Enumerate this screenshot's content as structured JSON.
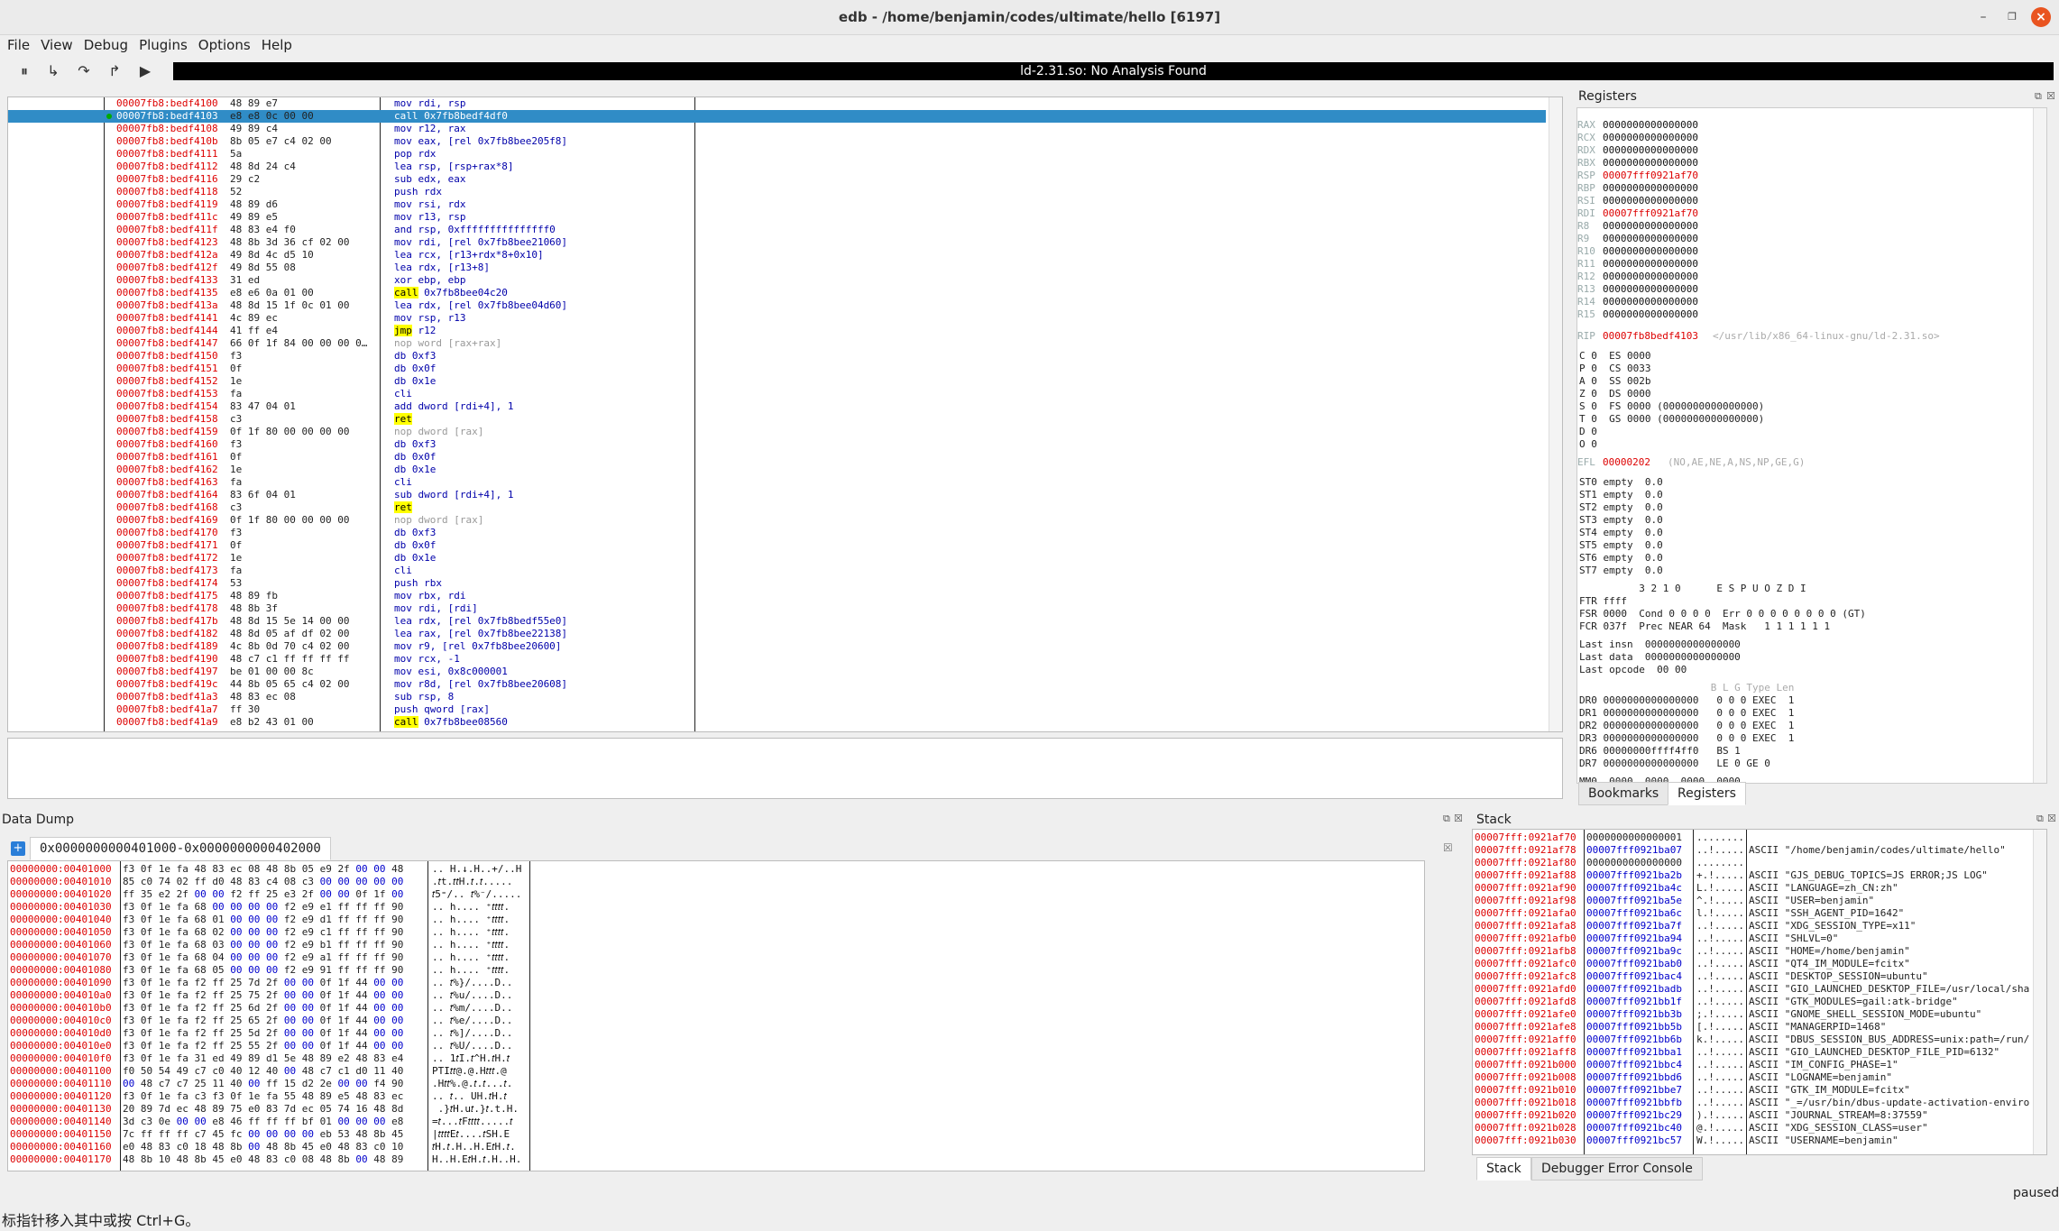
{
  "window": {
    "title": "edb - /home/benjamin/codes/ultimate/hello [6197]"
  },
  "menu": [
    "File",
    "View",
    "Debug",
    "Plugins",
    "Options",
    "Help"
  ],
  "toolbar": {
    "analysis_status": "ld-2.31.so: No Analysis Found"
  },
  "disasm": {
    "rows": [
      [
        "00007fb8:bedf4100",
        "48 89 e7",
        "mov rdi, rsp"
      ],
      [
        "00007fb8:bedf4103",
        "e8 e8 0c 00 00",
        "call 0x7fb8bedf4df0"
      ],
      [
        "00007fb8:bedf4108",
        "49 89 c4",
        "mov r12, rax"
      ],
      [
        "00007fb8:bedf410b",
        "8b 05 e7 c4 02 00",
        "mov eax, [rel 0x7fb8bee205f8]"
      ],
      [
        "00007fb8:bedf4111",
        "5a",
        "pop rdx"
      ],
      [
        "00007fb8:bedf4112",
        "48 8d 24 c4",
        "lea rsp, [rsp+rax*8]"
      ],
      [
        "00007fb8:bedf4116",
        "29 c2",
        "sub edx, eax"
      ],
      [
        "00007fb8:bedf4118",
        "52",
        "push rdx"
      ],
      [
        "00007fb8:bedf4119",
        "48 89 d6",
        "mov rsi, rdx"
      ],
      [
        "00007fb8:bedf411c",
        "49 89 e5",
        "mov r13, rsp"
      ],
      [
        "00007fb8:bedf411f",
        "48 83 e4 f0",
        "and rsp, 0xfffffffffffffff0"
      ],
      [
        "00007fb8:bedf4123",
        "48 8b 3d 36 cf 02 00",
        "mov rdi, [rel 0x7fb8bee21060]"
      ],
      [
        "00007fb8:bedf412a",
        "49 8d 4c d5 10",
        "lea rcx, [r13+rdx*8+0x10]"
      ],
      [
        "00007fb8:bedf412f",
        "49 8d 55 08",
        "lea rdx, [r13+8]"
      ],
      [
        "00007fb8:bedf4133",
        "31 ed",
        "xor ebp, ebp"
      ],
      [
        "00007fb8:bedf4135",
        "e8 e6 0a 01 00",
        "call 0x7fb8bee04c20"
      ],
      [
        "00007fb8:bedf413a",
        "48 8d 15 1f 0c 01 00",
        "lea rdx, [rel 0x7fb8bee04d60]"
      ],
      [
        "00007fb8:bedf4141",
        "4c 89 ec",
        "mov rsp, r13"
      ],
      [
        "00007fb8:bedf4144",
        "41 ff e4",
        "jmp r12"
      ],
      [
        "00007fb8:bedf4147",
        "66 0f 1f 84 00 00 00 0…",
        "nop word [rax+rax]"
      ],
      [
        "00007fb8:bedf4150",
        "f3",
        "db 0xf3"
      ],
      [
        "00007fb8:bedf4151",
        "0f",
        "db 0x0f"
      ],
      [
        "00007fb8:bedf4152",
        "1e",
        "db 0x1e"
      ],
      [
        "00007fb8:bedf4153",
        "fa",
        "cli"
      ],
      [
        "00007fb8:bedf4154",
        "83 47 04 01",
        "add dword [rdi+4], 1"
      ],
      [
        "00007fb8:bedf4158",
        "c3",
        "ret"
      ],
      [
        "00007fb8:bedf4159",
        "0f 1f 80 00 00 00 00",
        "nop dword [rax]"
      ],
      [
        "00007fb8:bedf4160",
        "f3",
        "db 0xf3"
      ],
      [
        "00007fb8:bedf4161",
        "0f",
        "db 0x0f"
      ],
      [
        "00007fb8:bedf4162",
        "1e",
        "db 0x1e"
      ],
      [
        "00007fb8:bedf4163",
        "fa",
        "cli"
      ],
      [
        "00007fb8:bedf4164",
        "83 6f 04 01",
        "sub dword [rdi+4], 1"
      ],
      [
        "00007fb8:bedf4168",
        "c3",
        "ret"
      ],
      [
        "00007fb8:bedf4169",
        "0f 1f 80 00 00 00 00",
        "nop dword [rax]"
      ],
      [
        "00007fb8:bedf4170",
        "f3",
        "db 0xf3"
      ],
      [
        "00007fb8:bedf4171",
        "0f",
        "db 0x0f"
      ],
      [
        "00007fb8:bedf4172",
        "1e",
        "db 0x1e"
      ],
      [
        "00007fb8:bedf4173",
        "fa",
        "cli"
      ],
      [
        "00007fb8:bedf4174",
        "53",
        "push rbx"
      ],
      [
        "00007fb8:bedf4175",
        "48 89 fb",
        "mov rbx, rdi"
      ],
      [
        "00007fb8:bedf4178",
        "48 8b 3f",
        "mov rdi, [rdi]"
      ],
      [
        "00007fb8:bedf417b",
        "48 8d 15 5e 14 00 00",
        "lea rdx, [rel 0x7fb8bedf55e0]"
      ],
      [
        "00007fb8:bedf4182",
        "48 8d 05 af df 02 00",
        "lea rax, [rel 0x7fb8bee22138]"
      ],
      [
        "00007fb8:bedf4189",
        "4c 8b 0d 70 c4 02 00",
        "mov r9, [rel 0x7fb8bee20600]"
      ],
      [
        "00007fb8:bedf4190",
        "48 c7 c1 ff ff ff ff",
        "mov rcx, -1"
      ],
      [
        "00007fb8:bedf4197",
        "be 01 00 00 8c",
        "mov esi, 0x8c000001"
      ],
      [
        "00007fb8:bedf419c",
        "44 8b 05 65 c4 02 00",
        "mov r8d, [rel 0x7fb8bee20608]"
      ],
      [
        "00007fb8:bedf41a3",
        "48 83 ec 08",
        "sub rsp, 8"
      ],
      [
        "00007fb8:bedf41a7",
        "ff 30",
        "push qword [rax]"
      ],
      [
        "00007fb8:bedf41a9",
        "e8 b2 43 01 00",
        "call 0x7fb8bee08560"
      ]
    ]
  },
  "registers": {
    "title": "Registers",
    "gp": [
      [
        "RAX",
        "0000000000000000"
      ],
      [
        "RCX",
        "0000000000000000"
      ],
      [
        "RDX",
        "0000000000000000"
      ],
      [
        "RBX",
        "0000000000000000"
      ],
      [
        "RSP",
        "00007fff0921af70"
      ],
      [
        "RBP",
        "0000000000000000"
      ],
      [
        "RSI",
        "0000000000000000"
      ],
      [
        "RDI",
        "00007fff0921af70"
      ],
      [
        "R8",
        "0000000000000000"
      ],
      [
        "R9",
        "0000000000000000"
      ],
      [
        "R10",
        "0000000000000000"
      ],
      [
        "R11",
        "0000000000000000"
      ],
      [
        "R12",
        "0000000000000000"
      ],
      [
        "R13",
        "0000000000000000"
      ],
      [
        "R14",
        "0000000000000000"
      ],
      [
        "R15",
        "0000000000000000"
      ]
    ],
    "rip": [
      "RIP",
      "00007fb8bedf4103",
      "</usr/lib/x86_64-linux-gnu/ld-2.31.so>"
    ],
    "flags_seg": [
      "C 0  ES 0000",
      "P 0  CS 0033",
      "A 0  SS 002b",
      "Z 0  DS 0000",
      "S 0  FS 0000 (0000000000000000)",
      "T 0  GS 0000 (0000000000000000)",
      "D 0",
      "O 0"
    ],
    "efl": [
      "EFL",
      "00000202",
      "(NO,AE,NE,A,NS,NP,GE,G)"
    ],
    "fpu": [
      "ST0 empty  0.0",
      "ST1 empty  0.0",
      "ST2 empty  0.0",
      "ST3 empty  0.0",
      "ST4 empty  0.0",
      "ST5 empty  0.0",
      "ST6 empty  0.0",
      "ST7 empty  0.0"
    ],
    "fpu_ctl": [
      "          3 2 1 0      E S P U O Z D I",
      "FTR ffff",
      "FSR 0000  Cond 0 0 0 0  Err 0 0 0 0 0 0 0 0 (GT)",
      "FCR 037f  Prec NEAR 64  Mask   1 1 1 1 1 1"
    ],
    "last": [
      "Last insn  0000000000000000",
      "Last data  0000000000000000",
      "Last opcode  00 00"
    ],
    "dr_header": "                      B L G Type Len",
    "dr": [
      "DR0 0000000000000000   0 0 0 EXEC  1",
      "DR1 0000000000000000   0 0 0 EXEC  1",
      "DR2 0000000000000000   0 0 0 EXEC  1",
      "DR3 0000000000000000   0 0 0 EXEC  1",
      "DR6 00000000ffff4ff0   BS 1",
      "DR7 0000000000000000   LE 0 GE 0"
    ],
    "mm0": "MM0  0000  0000  0000  0000",
    "tabs": [
      "Bookmarks",
      "Registers"
    ]
  },
  "data_dump": {
    "title": "Data Dump",
    "tab": "0x0000000000401000-0x0000000000402000",
    "rows": [
      [
        "00000000:00401000",
        "f3 0f 1e fa 48 83 ec 08 48 8b 05 e9 2f 00 00 48",
        ".. H.↓.H..+/..H"
      ],
      [
        "00000000:00401010",
        "85 c0 74 02 ff d0 48 83 c4 08 c3 00 00 00 00 00",
        ".𝑡t.𝑡𝑡H.𝑡.𝑡....."
      ],
      [
        "00000000:00401020",
        "ff 35 e2 2f 00 00 f2 ff 25 e3 2f 00 00 0f 1f 00",
        "𝑡5⁼/.. 𝑡%⁻/....."
      ],
      [
        "00000000:00401030",
        "f3 0f 1e fa 68 00 00 00 00 f2 e9 e1 ff ff ff 90",
        ".. h.... ⁺𝑡𝑡𝑡𝑡."
      ],
      [
        "00000000:00401040",
        "f3 0f 1e fa 68 01 00 00 00 f2 e9 d1 ff ff ff 90",
        ".. h.... ⁺𝑡𝑡𝑡𝑡."
      ],
      [
        "00000000:00401050",
        "f3 0f 1e fa 68 02 00 00 00 f2 e9 c1 ff ff ff 90",
        ".. h.... ⁺𝑡𝑡𝑡𝑡."
      ],
      [
        "00000000:00401060",
        "f3 0f 1e fa 68 03 00 00 00 f2 e9 b1 ff ff ff 90",
        ".. h.... ⁺𝑡𝑡𝑡𝑡."
      ],
      [
        "00000000:00401070",
        "f3 0f 1e fa 68 04 00 00 00 f2 e9 a1 ff ff ff 90",
        ".. h.... ⁺𝑡𝑡𝑡𝑡."
      ],
      [
        "00000000:00401080",
        "f3 0f 1e fa 68 05 00 00 00 f2 e9 91 ff ff ff 90",
        ".. h.... ⁺𝑡𝑡𝑡𝑡."
      ],
      [
        "00000000:00401090",
        "f3 0f 1e fa f2 ff 25 7d 2f 00 00 0f 1f 44 00 00",
        ".. 𝑡%}/....D.."
      ],
      [
        "00000000:004010a0",
        "f3 0f 1e fa f2 ff 25 75 2f 00 00 0f 1f 44 00 00",
        ".. 𝑡%u/....D.."
      ],
      [
        "00000000:004010b0",
        "f3 0f 1e fa f2 ff 25 6d 2f 00 00 0f 1f 44 00 00",
        ".. 𝑡%m/....D.."
      ],
      [
        "00000000:004010c0",
        "f3 0f 1e fa f2 ff 25 65 2f 00 00 0f 1f 44 00 00",
        ".. 𝑡%e/....D.."
      ],
      [
        "00000000:004010d0",
        "f3 0f 1e fa f2 ff 25 5d 2f 00 00 0f 1f 44 00 00",
        ".. 𝑡%]/....D.."
      ],
      [
        "00000000:004010e0",
        "f3 0f 1e fa f2 ff 25 55 2f 00 00 0f 1f 44 00 00",
        ".. 𝑡%U/....D.."
      ],
      [
        "00000000:004010f0",
        "f3 0f 1e fa 31 ed 49 89 d1 5e 48 89 e2 48 83 e4",
        ".. 1𝑡I.𝑡^H.𝑡H.𝑡"
      ],
      [
        "00000000:00401100",
        "f0 50 54 49 c7 c0 40 12 40 00 48 c7 c1 d0 11 40",
        "PTI𝑡𝑡@.@.H𝑡𝑡𝑡.@"
      ],
      [
        "00000000:00401110",
        "00 48 c7 c7 25 11 40 00 ff 15 d2 2e 00 00 f4 90",
        ".H𝑡𝑡%.@.𝑡.𝑡...𝑡."
      ],
      [
        "00000000:00401120",
        "f3 0f 1e fa c3 f3 0f 1e fa 55 48 89 e5 48 83 ec",
        ".. 𝑡.. UH.𝑡H.𝑡"
      ],
      [
        "00000000:00401130",
        "20 89 7d ec 48 89 75 e0 83 7d ec 05 74 16 48 8d",
        " .}𝑡H.u𝑡.}𝑡.t.H."
      ],
      [
        "00000000:00401140",
        "3d c3 0e 00 00 e8 46 ff ff ff bf 01 00 00 00 e8",
        "=𝑡...𝑡F𝑡𝑡𝑡𝑡.....𝑡"
      ],
      [
        "00000000:00401150",
        "7c ff ff ff c7 45 fc 00 00 00 00 eb 53 48 8b 45",
        "|𝑡𝑡𝑡𝑡E𝑡....𝑡SH.E"
      ],
      [
        "00000000:00401160",
        "e0 48 83 c0 18 48 8b 00 48 8b 45 e0 48 83 c0 10",
        "𝑡H.𝑡.H..H.E𝑡H.𝑡."
      ],
      [
        "00000000:00401170",
        "48 8b 10 48 8b 45 e0 48 83 c0 08 48 8b 00 48 89",
        "H..H.E𝑡H.𝑡.H..H."
      ]
    ]
  },
  "stack": {
    "title": "Stack",
    "rows": [
      [
        "00007fff:0921af70",
        "0000000000000001",
        "........",
        ""
      ],
      [
        "00007fff:0921af78",
        "00007fff0921ba07",
        "..!.....",
        "ASCII \"/home/benjamin/codes/ultimate/hello\""
      ],
      [
        "00007fff:0921af80",
        "0000000000000000",
        "........",
        ""
      ],
      [
        "00007fff:0921af88",
        "00007fff0921ba2b",
        "+.!.....",
        "ASCII \"GJS_DEBUG_TOPICS=JS ERROR;JS LOG\""
      ],
      [
        "00007fff:0921af90",
        "00007fff0921ba4c",
        "L.!.....",
        "ASCII \"LANGUAGE=zh_CN:zh\""
      ],
      [
        "00007fff:0921af98",
        "00007fff0921ba5e",
        "^.!.....",
        "ASCII \"USER=benjamin\""
      ],
      [
        "00007fff:0921afa0",
        "00007fff0921ba6c",
        "l.!.....",
        "ASCII \"SSH_AGENT_PID=1642\""
      ],
      [
        "00007fff:0921afa8",
        "00007fff0921ba7f",
        "..!.....",
        "ASCII \"XDG_SESSION_TYPE=x11\""
      ],
      [
        "00007fff:0921afb0",
        "00007fff0921ba94",
        "..!.....",
        "ASCII \"SHLVL=0\""
      ],
      [
        "00007fff:0921afb8",
        "00007fff0921ba9c",
        "..!.....",
        "ASCII \"HOME=/home/benjamin\""
      ],
      [
        "00007fff:0921afc0",
        "00007fff0921bab0",
        "..!.....",
        "ASCII \"QT4_IM_MODULE=fcitx\""
      ],
      [
        "00007fff:0921afc8",
        "00007fff0921bac4",
        "..!.....",
        "ASCII \"DESKTOP_SESSION=ubuntu\""
      ],
      [
        "00007fff:0921afd0",
        "00007fff0921badb",
        "..!.....",
        "ASCII \"GIO_LAUNCHED_DESKTOP_FILE=/usr/local/sha"
      ],
      [
        "00007fff:0921afd8",
        "00007fff0921bb1f",
        "..!.....",
        "ASCII \"GTK_MODULES=gail:atk-bridge\""
      ],
      [
        "00007fff:0921afe0",
        "00007fff0921bb3b",
        ";.!.....",
        "ASCII \"GNOME_SHELL_SESSION_MODE=ubuntu\""
      ],
      [
        "00007fff:0921afe8",
        "00007fff0921bb5b",
        "[.!.....",
        "ASCII \"MANAGERPID=1468\""
      ],
      [
        "00007fff:0921aff0",
        "00007fff0921bb6b",
        "k.!.....",
        "ASCII \"DBUS_SESSION_BUS_ADDRESS=unix:path=/run/"
      ],
      [
        "00007fff:0921aff8",
        "00007fff0921bba1",
        "..!.....",
        "ASCII \"GIO_LAUNCHED_DESKTOP_FILE_PID=6132\""
      ],
      [
        "00007fff:0921b000",
        "00007fff0921bbc4",
        "..!.....",
        "ASCII \"IM_CONFIG_PHASE=1\""
      ],
      [
        "00007fff:0921b008",
        "00007fff0921bbd6",
        "..!.....",
        "ASCII \"LOGNAME=benjamin\""
      ],
      [
        "00007fff:0921b010",
        "00007fff0921bbe7",
        "..!.....",
        "ASCII \"GTK_IM_MODULE=fcitx\""
      ],
      [
        "00007fff:0921b018",
        "00007fff0921bbfb",
        "..!.....",
        "ASCII \"_=/usr/bin/dbus-update-activation-enviro"
      ],
      [
        "00007fff:0921b020",
        "00007fff0921bc29",
        ").!.....",
        "ASCII \"JOURNAL_STREAM=8:37559\""
      ],
      [
        "00007fff:0921b028",
        "00007fff0921bc40",
        "@.!.....",
        "ASCII \"XDG_SESSION_CLASS=user\""
      ],
      [
        "00007fff:0921b030",
        "00007fff0921bc57",
        "W.!.....",
        "ASCII \"USERNAME=benjamin\""
      ]
    ],
    "tabs": [
      "Stack",
      "Debugger Error Console"
    ]
  },
  "status": {
    "state": "paused",
    "hint": "标指针移入其中或按 Ctrl+G。"
  }
}
